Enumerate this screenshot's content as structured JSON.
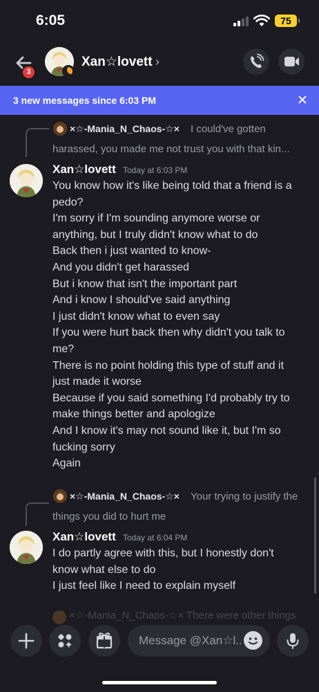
{
  "status_bar": {
    "time": "6:05",
    "battery": "75"
  },
  "header": {
    "unread_count": "3",
    "title": "Xan☆lovett",
    "chevron": "›",
    "icons": {
      "back": "arrow-left-icon",
      "call": "phone-icon",
      "video": "video-camera-icon",
      "status": "idle-moon-icon"
    }
  },
  "banner": {
    "text": "3 new messages since 6:03 PM",
    "close": "✕"
  },
  "messages": [
    {
      "reply": {
        "author": "×☆-Mania_N_Chaos-☆×",
        "text_line1": "I could've gotten",
        "text_line2": "harassed, you made me not trust you with that kin..."
      },
      "author": "Xan☆lovett",
      "time": "Today at 6:03 PM",
      "lines": [
        "You know how it's like being told that a friend is a",
        "pedo?",
        "I'm sorry if I'm sounding  anymore worse or",
        "anything, but I truly didn't know what to do",
        "Back then i just wanted to know-",
        "And you didn't get harassed",
        "But i know that isn't the important part",
        "And i know I should've said anything",
        "I just didn't know what to even say",
        "If you were hurt back then why didn't you talk to",
        "me?",
        "There is no point holding this type of stuff and it",
        "just made it worse",
        "Because if you said something I'd probably try to",
        "make things better and apologize",
        "And I know it's may not sound like it, but I'm so",
        "fucking sorry",
        "Again"
      ]
    },
    {
      "reply": {
        "author": "×☆-Mania_N_Chaos-☆×",
        "text_line1": "Your trying to justify the",
        "text_line2": "things you did to hurt me"
      },
      "author": "Xan☆lovett",
      "time": "Today at 6:04 PM",
      "lines": [
        "I do partly agree with this, but I honestly don't",
        "know what else to do",
        "I just feel like I need to explain myself"
      ]
    }
  ],
  "partial_next": "×☆-Mania_N_Chaos-☆× There were other things",
  "composer": {
    "placeholder": "Message @Xan☆l..",
    "icons": {
      "add": "plus-icon",
      "apps": "apps-icon",
      "gift": "gift-icon",
      "emoji": "emoji-icon",
      "mic": "microphone-icon"
    }
  },
  "colors": {
    "background": "#1b1b21",
    "accent": "#5865f2",
    "badge": "#e23b3b",
    "idle": "#f0a12a"
  }
}
